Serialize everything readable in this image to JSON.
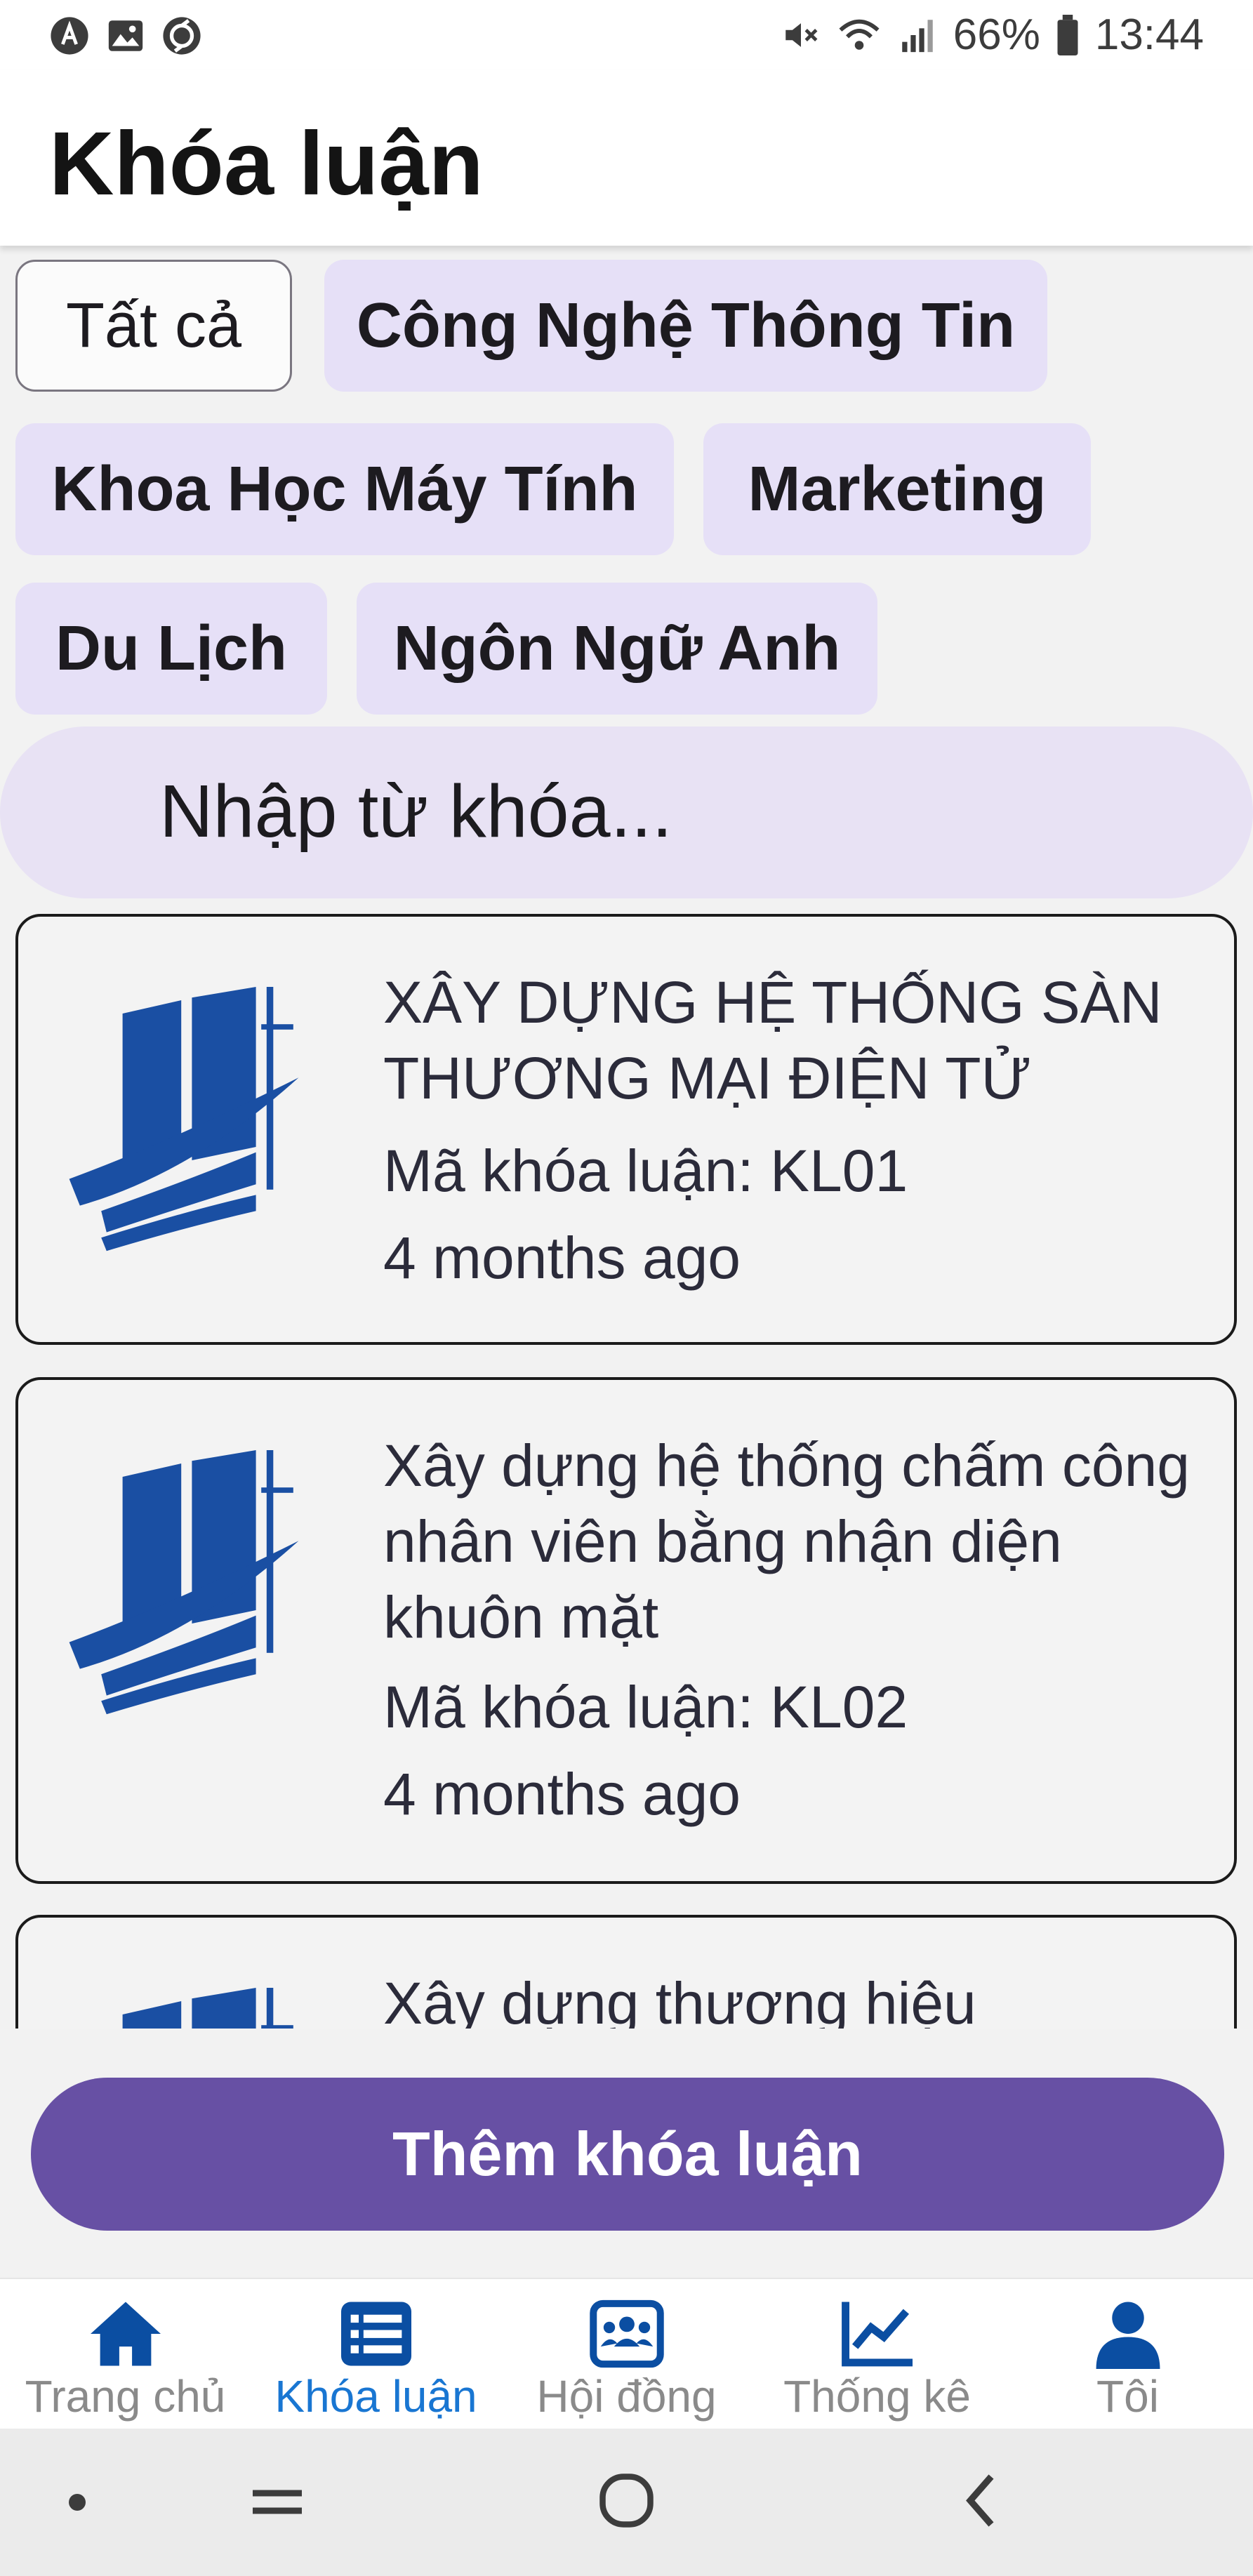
{
  "status_bar": {
    "battery": "66%",
    "time": "13:44",
    "left_icons": [
      "app-a-icon",
      "gallery-icon",
      "sync-icon"
    ],
    "right_icons": [
      "mute-icon",
      "wifi-icon",
      "signal-icon",
      "battery-icon"
    ]
  },
  "header": {
    "title": "Khóa luận"
  },
  "filters": {
    "chips": [
      {
        "label": "Tất cả",
        "selected": true
      },
      {
        "label": "Công Nghệ Thông Tin",
        "selected": false
      },
      {
        "label": "Khoa Học Máy Tính",
        "selected": false
      },
      {
        "label": "Marketing",
        "selected": false
      },
      {
        "label": "Du Lịch",
        "selected": false
      },
      {
        "label": "Ngôn Ngữ Anh",
        "selected": false
      }
    ]
  },
  "search": {
    "placeholder": "Nhập từ khóa..."
  },
  "theses": [
    {
      "title": "XÂY DỰNG HỆ THỐNG SÀN THƯƠNG MẠI ĐIỆN TỬ",
      "code": "Mã khóa luận: KL01",
      "time": "4 months ago"
    },
    {
      "title": "Xây dựng hệ thống chấm công nhân viên bằng nhận diện khuôn mặt",
      "code": "Mã khóa luận: KL02",
      "time": "4 months ago"
    },
    {
      "title": "Xây dựng thương hiệu"
    }
  ],
  "primary_button": {
    "label": "Thêm khóa luận"
  },
  "bottom_nav": {
    "items": [
      {
        "label": "Trang chủ",
        "icon": "home-icon",
        "active": false
      },
      {
        "label": "Khóa luận",
        "icon": "list-icon",
        "active": true
      },
      {
        "label": "Hội đồng",
        "icon": "group-icon",
        "active": false
      },
      {
        "label": "Thống kê",
        "icon": "chart-icon",
        "active": false
      },
      {
        "label": "Tôi",
        "icon": "person-icon",
        "active": false
      }
    ]
  },
  "colors": {
    "primary": "#6750a4",
    "chip_bg": "#e6e0f7",
    "nav_icon": "#0b4ea2",
    "nav_active_label": "#1976d2",
    "logo_blue": "#1a4fa3"
  }
}
